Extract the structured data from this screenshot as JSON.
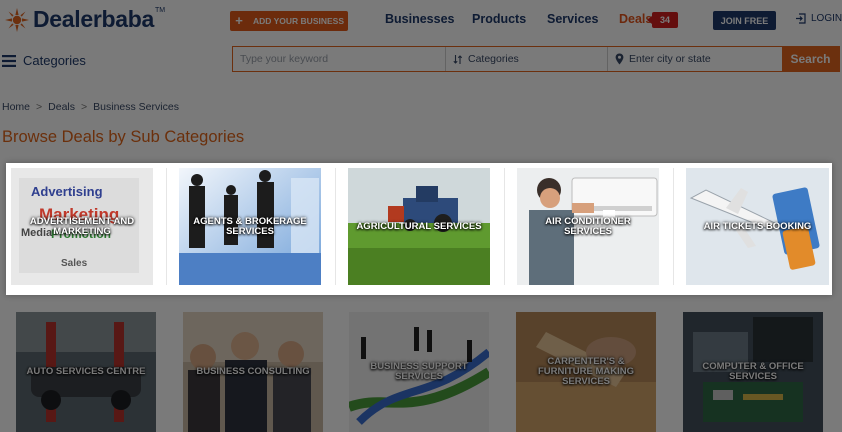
{
  "header": {
    "logo_text": "Dealerbaba",
    "logo_tm": "TM",
    "add_business_label": "ADD YOUR BUSINESS",
    "nav": {
      "businesses": "Businesses",
      "products": "Products",
      "services": "Services",
      "deals": "Deals",
      "deals_count": "34"
    },
    "join_label": "JOIN FREE",
    "login_label": "LOGIN"
  },
  "search": {
    "categories_menu_label": "Categories",
    "keyword_placeholder": "Type your keyword",
    "category_label": "Categories",
    "city_placeholder": "Enter city or state",
    "button_label": "Search"
  },
  "breadcrumb": {
    "home": "Home",
    "deals": "Deals",
    "current": "Business Services"
  },
  "page_title": "Browse Deals by Sub Categories",
  "categories_row1": [
    {
      "label": "ADVERTISEMENT AND MARKETING"
    },
    {
      "label": "AGENTS & BROKERAGE SERVICES"
    },
    {
      "label": "AGRICULTURAL SERVICES"
    },
    {
      "label": "AIR CONDITIONER SERVICES"
    },
    {
      "label": "AIR TICKETS BOOKING"
    }
  ],
  "categories_row2": [
    {
      "label": "AUTO SERVICES CENTRE"
    },
    {
      "label": "BUSINESS CONSULTING"
    },
    {
      "label": "BUSINESS SUPPORT SERVICES"
    },
    {
      "label": "CARPENTER'S & FURNITURE MAKING SERVICES"
    },
    {
      "label": "COMPUTER & OFFICE SERVICES"
    }
  ],
  "colors": {
    "brand_blue": "#1f3a6b",
    "brand_orange": "#e2641e",
    "badge_red": "#d21f1f"
  }
}
